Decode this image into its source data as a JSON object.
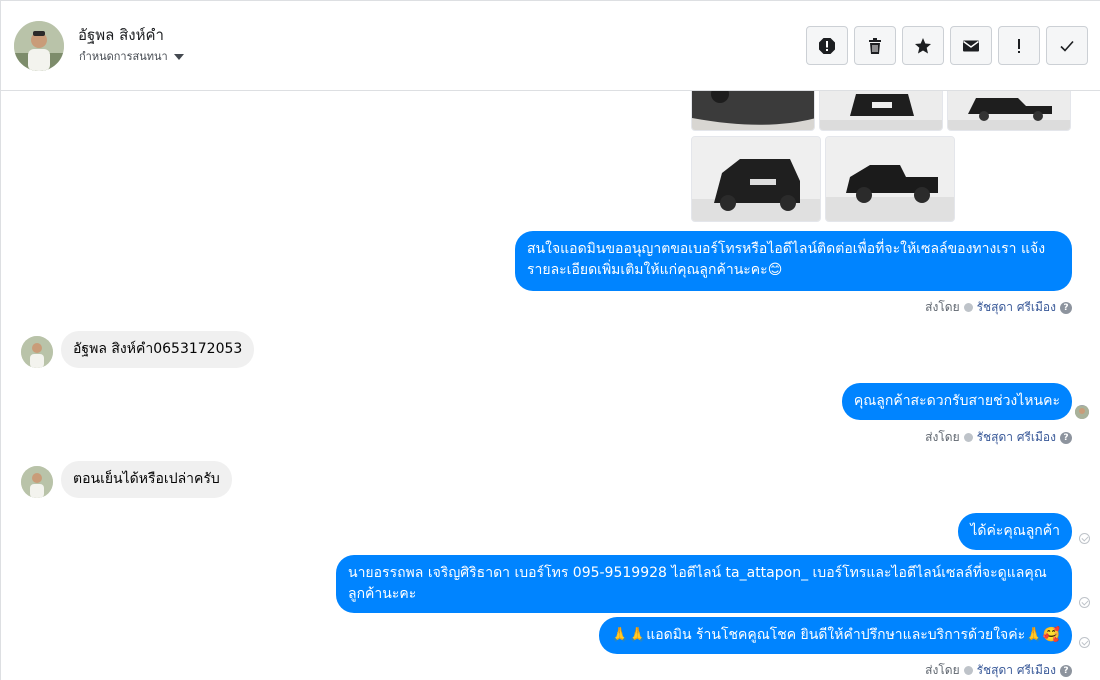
{
  "header": {
    "contact_name": "อัฐพล สิงห์คำ",
    "assign_label": "กำหนดการสนทนา",
    "actions": [
      "spam-icon",
      "trash-icon",
      "star-icon",
      "envelope-icon",
      "exclamation-icon",
      "checkmark-icon"
    ]
  },
  "messages": {
    "m1": "สนใจแอดมินขออนุญาตขอเบอร์โทรหรือไอดีไลน์ติดต่อเพื่อที่จะให้เซลล์ของทางเรา แจ้งรายละเอียดเพิ่มเติมให้แก่คุณลูกค้านะคะ😊",
    "m2": "อัฐพล สิงห์คำ0653172053",
    "m3": "คุณลูกค้าสะดวกรับสายช่วงไหนคะ",
    "m4": "ตอนเย็นได้หรือเปล่าครับ",
    "m5": "ได้ค่ะคุณลูกค้า",
    "m6": "นายอรรถพล เจริญศิริธาดา      เบอร์โทร 095-9519928 ไอดีไลน์ ta_attapon_   เบอร์โทรและไอดีไลน์เซลล์ที่จะดูแลคุณลูกค้านะคะ",
    "m7": "🙏🙏แอดมิน ร้านโชคคูณโชค ยินดีให้คำปรึกษาและบริการด้วยใจค่ะ🙏🥰"
  },
  "sent_by": {
    "prefix": "ส่งโดย",
    "agent": "รัชสุดา ศรีเมือง"
  },
  "colors": {
    "outgoing_bubble": "#0084ff",
    "incoming_bubble": "#f0f0f0",
    "agent_link": "#385898"
  }
}
